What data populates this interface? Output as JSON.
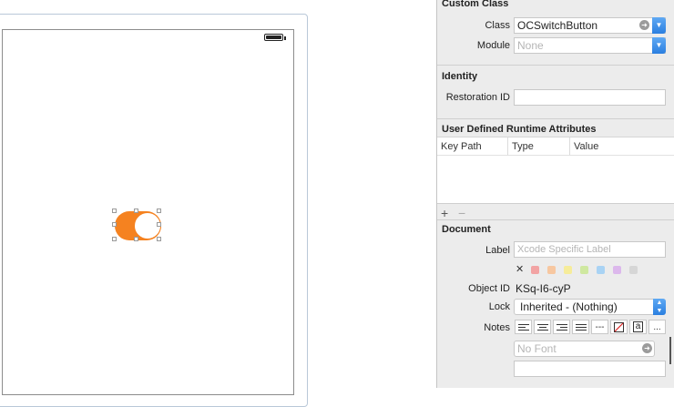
{
  "canvas": {
    "switch": {
      "accent": "#f58220",
      "state": "on"
    }
  },
  "custom_class": {
    "title": "Custom Class",
    "class_label": "Class",
    "class_value": "OCSwitchButton",
    "module_label": "Module",
    "module_placeholder": "None"
  },
  "identity": {
    "title": "Identity",
    "restoration_label": "Restoration ID",
    "restoration_value": ""
  },
  "runtime_attributes": {
    "title": "User Defined Runtime Attributes",
    "columns": [
      "Key Path",
      "Type",
      "Value"
    ],
    "add_label": "+",
    "remove_label": "−"
  },
  "document": {
    "title": "Document",
    "label_label": "Label",
    "label_placeholder": "Xcode Specific Label",
    "clear_label": "✕",
    "label_colors": [
      "#f2a3a3",
      "#f7c7a0",
      "#f6ec9a",
      "#cfe8a0",
      "#a9d3f4",
      "#dcb8ec",
      "#d6d6d6"
    ],
    "object_id_label": "Object ID",
    "object_id_value": "KSq-I6-cyP",
    "lock_label": "Lock",
    "lock_value": "Inherited - (Nothing)",
    "notes_label": "Notes",
    "notes_font_placeholder": "No Font",
    "notes_tools": [
      "align-left",
      "align-center",
      "align-right",
      "justify",
      "separator",
      "no-color",
      "text-color",
      "more"
    ],
    "notes_sep_label": "---",
    "notes_text_color_label": "a",
    "notes_more_label": "..."
  }
}
